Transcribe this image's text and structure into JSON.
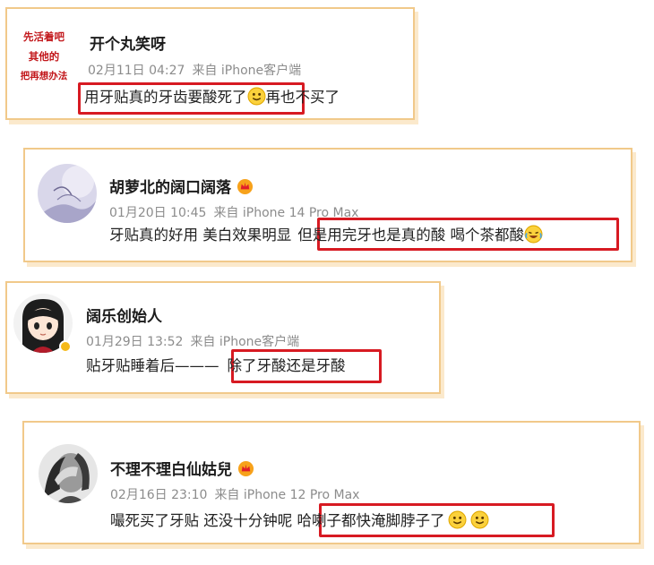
{
  "comments": [
    {
      "avatar_text": [
        "先活着吧",
        "其他的",
        "把再想办法"
      ],
      "username": "开个丸笑呀",
      "date": "02月11日 04:27",
      "source": "来自 iPhone客户端",
      "text_highlight": "用牙贴真的牙齿要酸死了",
      "text_after": "再也不买了"
    },
    {
      "username": "胡萝北的阔口阔落",
      "date": "01月20日 10:45",
      "source": "来自 iPhone 14 Pro Max",
      "text_before": "牙贴真的好用 美白效果明显",
      "text_highlight": "但是用完牙也是真的酸 喝个茶都酸"
    },
    {
      "username": "阔乐创始人",
      "date": "01月29日 13:52",
      "source": "来自 iPhone客户端",
      "text_before": "贴牙贴睡着后———",
      "text_highlight": "除了牙酸还是牙酸"
    },
    {
      "username": "不理不理白仙姑兒",
      "date": "02月16日 23:10",
      "source": "来自 iPhone 12 Pro Max",
      "text_before": "嘬死买了牙贴 还没十分钟呢 ",
      "text_highlight": "哈喇子都快淹脚脖子了"
    }
  ],
  "colors": {
    "card_border": "#f1c98a",
    "highlight": "#d71a22",
    "meta": "#8c8c8c"
  }
}
